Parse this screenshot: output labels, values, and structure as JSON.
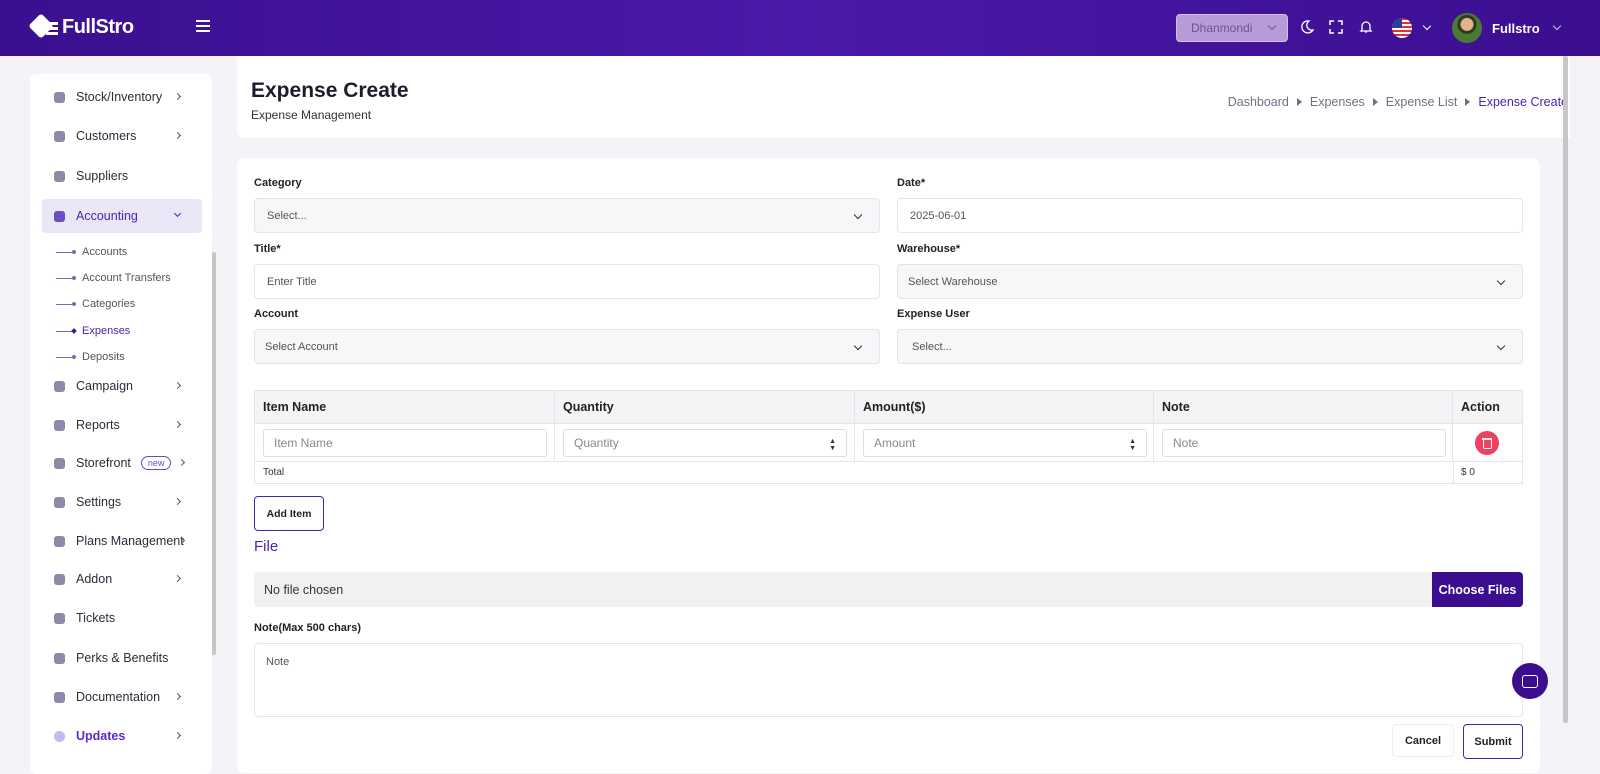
{
  "topbar": {
    "brand": "FullStro",
    "branch_select": "Dhanmondi",
    "user_name": "Fullstro",
    "icons": [
      "menu-icon",
      "moon-icon",
      "fullscreen-icon",
      "bell-icon",
      "us-flag-icon",
      "chevron-down-icon"
    ]
  },
  "sidebar": {
    "items": [
      {
        "label": "Stock/Inventory",
        "icon": "box-icon",
        "has_arrow": true
      },
      {
        "label": "Customers",
        "icon": "users-icon",
        "has_arrow": true
      },
      {
        "label": "Suppliers",
        "icon": "supplier-icon",
        "has_arrow": false
      },
      {
        "label": "Accounting",
        "icon": "accounting-icon",
        "has_arrow": true,
        "expanded": true
      },
      {
        "label": "Campaign",
        "icon": "campaign-icon",
        "has_arrow": true
      },
      {
        "label": "Reports",
        "icon": "report-icon",
        "has_arrow": true
      },
      {
        "label": "Storefront",
        "icon": "storefront-icon",
        "has_arrow": true,
        "badge": "new"
      },
      {
        "label": "Settings",
        "icon": "settings-icon",
        "has_arrow": true
      },
      {
        "label": "Plans Management",
        "icon": "plans-icon",
        "has_arrow": true
      },
      {
        "label": "Addon",
        "icon": "addon-icon",
        "has_arrow": true
      },
      {
        "label": "Tickets",
        "icon": "ticket-icon",
        "has_arrow": false
      },
      {
        "label": "Perks & Benefits",
        "icon": "perks-icon",
        "has_arrow": false
      },
      {
        "label": "Documentation",
        "icon": "doc-icon",
        "has_arrow": true
      },
      {
        "label": "Updates",
        "icon": "updates-icon",
        "has_arrow": true
      }
    ],
    "accounting_sub": [
      "Accounts",
      "Account Transfers",
      "Categories",
      "Expenses",
      "Deposits"
    ],
    "active_sub": "Expenses"
  },
  "header": {
    "title": "Expense Create",
    "subtitle": "Expense Management",
    "breadcrumb": [
      "Dashboard",
      "Expenses",
      "Expense List",
      "Expense Create"
    ]
  },
  "form": {
    "category": {
      "label": "Category",
      "value": "Select..."
    },
    "date": {
      "label": "Date*",
      "value": "2025-06-01"
    },
    "title": {
      "label": "Title*",
      "placeholder": "Enter Title"
    },
    "warehouse": {
      "label": "Warehouse*",
      "value": "Select Warehouse"
    },
    "account": {
      "label": "Account",
      "value": "Select Account"
    },
    "expense_user": {
      "label": "Expense User",
      "value": "Select..."
    }
  },
  "items_table": {
    "headers": [
      "Item Name",
      "Quantity",
      "Amount($)",
      "Note",
      "Action"
    ],
    "row": {
      "item_name": "Item Name",
      "quantity": "Quantity",
      "amount": "Amount",
      "note": "Note"
    },
    "total_label": "Total",
    "total_value": "$ 0"
  },
  "add_item_label": "Add Item",
  "file": {
    "title": "File",
    "status": "No file chosen",
    "button": "Choose Files"
  },
  "note": {
    "label": "Note(Max 500 chars)",
    "placeholder": "Note"
  },
  "actions": {
    "cancel": "Cancel",
    "submit": "Submit"
  },
  "colors": {
    "brand": "#3b0e90",
    "accent": "#4a24a8",
    "danger": "#f0405e"
  }
}
